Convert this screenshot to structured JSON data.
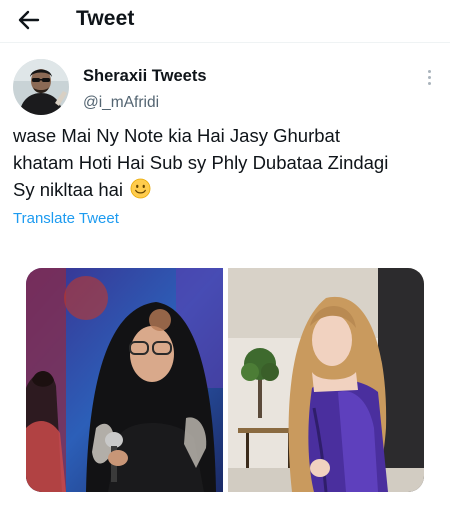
{
  "header": {
    "back_icon": "arrow-left-icon",
    "title": "Tweet"
  },
  "author": {
    "display_name": "Sheraxii Tweets",
    "handle": "@i_mAfridi",
    "avatar_icon": "avatar"
  },
  "more_icon": "more-vertical-icon",
  "tweet": {
    "lines": [
      "wase Mai Ny Note kia Hai Jasy Ghurbat",
      "khatam Hoti Hai Sub sy Phly Dubataa Zindagi",
      "Sy nikltaa hai"
    ],
    "emoji": "slightly-smiling-face"
  },
  "translate_label": "Translate Tweet",
  "media": {
    "photo_count": 2
  },
  "colors": {
    "text": "#0f1419",
    "secondary": "#536471",
    "link": "#1d9bf0",
    "divider": "#eff3f4"
  }
}
